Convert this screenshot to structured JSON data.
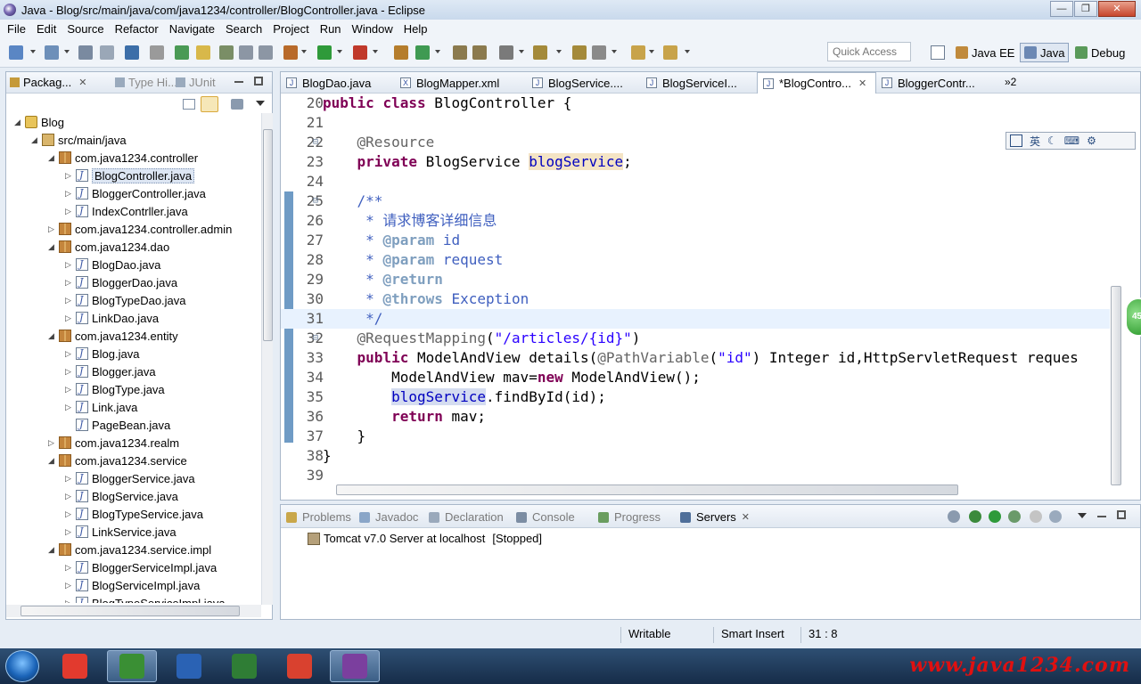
{
  "window": {
    "title": "Java - Blog/src/main/java/com/java1234/controller/BlogController.java - Eclipse"
  },
  "menu": [
    "File",
    "Edit",
    "Source",
    "Refactor",
    "Navigate",
    "Search",
    "Project",
    "Run",
    "Window",
    "Help"
  ],
  "toolbar": {
    "quick_access_placeholder": "Quick Access"
  },
  "perspectives": [
    {
      "label": "Java EE",
      "active": false
    },
    {
      "label": "Java",
      "active": true
    },
    {
      "label": "Debug",
      "active": false
    }
  ],
  "left_tabs": [
    {
      "label": "Packag...",
      "closable": true
    },
    {
      "label": "Type Hi...",
      "closable": false
    },
    {
      "label": "JUnit",
      "closable": false
    }
  ],
  "tree": [
    {
      "label": "Blog",
      "indent": 0,
      "icon": "project-icon",
      "twisty": "open"
    },
    {
      "label": "src/main/java",
      "indent": 1,
      "icon": "source-folder-icon",
      "twisty": "open"
    },
    {
      "label": "com.java1234.controller",
      "indent": 2,
      "icon": "package-icon",
      "twisty": "open"
    },
    {
      "label": "BlogController.java",
      "indent": 3,
      "icon": "java-file-icon",
      "twisty": "closed",
      "selected": true
    },
    {
      "label": "BloggerController.java",
      "indent": 3,
      "icon": "java-file-icon",
      "twisty": "closed"
    },
    {
      "label": "IndexContrller.java",
      "indent": 3,
      "icon": "java-file-icon",
      "twisty": "closed"
    },
    {
      "label": "com.java1234.controller.admin",
      "indent": 2,
      "icon": "package-icon",
      "twisty": "closed"
    },
    {
      "label": "com.java1234.dao",
      "indent": 2,
      "icon": "package-icon",
      "twisty": "open"
    },
    {
      "label": "BlogDao.java",
      "indent": 3,
      "icon": "java-file-icon",
      "twisty": "closed"
    },
    {
      "label": "BloggerDao.java",
      "indent": 3,
      "icon": "java-file-icon",
      "twisty": "closed"
    },
    {
      "label": "BlogTypeDao.java",
      "indent": 3,
      "icon": "java-file-icon",
      "twisty": "closed"
    },
    {
      "label": "LinkDao.java",
      "indent": 3,
      "icon": "java-file-icon",
      "twisty": "closed"
    },
    {
      "label": "com.java1234.entity",
      "indent": 2,
      "icon": "package-icon",
      "twisty": "open"
    },
    {
      "label": "Blog.java",
      "indent": 3,
      "icon": "java-file-icon",
      "twisty": "closed"
    },
    {
      "label": "Blogger.java",
      "indent": 3,
      "icon": "java-file-icon",
      "twisty": "closed"
    },
    {
      "label": "BlogType.java",
      "indent": 3,
      "icon": "java-file-icon",
      "twisty": "closed"
    },
    {
      "label": "Link.java",
      "indent": 3,
      "icon": "java-file-icon",
      "twisty": "closed"
    },
    {
      "label": "PageBean.java",
      "indent": 3,
      "icon": "java-file-icon",
      "twisty": "none"
    },
    {
      "label": "com.java1234.realm",
      "indent": 2,
      "icon": "package-icon",
      "twisty": "closed"
    },
    {
      "label": "com.java1234.service",
      "indent": 2,
      "icon": "package-icon",
      "twisty": "open"
    },
    {
      "label": "BloggerService.java",
      "indent": 3,
      "icon": "java-file-icon",
      "twisty": "closed"
    },
    {
      "label": "BlogService.java",
      "indent": 3,
      "icon": "java-file-icon",
      "twisty": "closed"
    },
    {
      "label": "BlogTypeService.java",
      "indent": 3,
      "icon": "java-file-icon",
      "twisty": "closed"
    },
    {
      "label": "LinkService.java",
      "indent": 3,
      "icon": "java-file-icon",
      "twisty": "closed"
    },
    {
      "label": "com.java1234.service.impl",
      "indent": 2,
      "icon": "package-icon",
      "twisty": "open"
    },
    {
      "label": "BloggerServiceImpl.java",
      "indent": 3,
      "icon": "java-file-icon",
      "twisty": "closed"
    },
    {
      "label": "BlogServiceImpl.java",
      "indent": 3,
      "icon": "java-file-icon",
      "twisty": "closed"
    },
    {
      "label": "BlogTypeServiceImpl.java",
      "indent": 3,
      "icon": "java-file-icon",
      "twisty": "closed"
    }
  ],
  "editor_tabs": [
    {
      "label": "BlogDao.java",
      "icon": "J",
      "active": false
    },
    {
      "label": "BlogMapper.xml",
      "icon": "X",
      "active": false
    },
    {
      "label": "BlogService....",
      "icon": "J",
      "active": false
    },
    {
      "label": "BlogServiceI...",
      "icon": "J",
      "active": false
    },
    {
      "label": "*BlogContro...",
      "icon": "J",
      "active": true
    },
    {
      "label": "BloggerContr...",
      "icon": "J",
      "active": false
    }
  ],
  "editor_overflow": "»2",
  "code_lines": [
    {
      "n": "20",
      "tokens": [
        [
          "kw",
          "public"
        ],
        [
          "t",
          " "
        ],
        [
          "kw",
          "class"
        ],
        [
          "t",
          " BlogController {"
        ]
      ]
    },
    {
      "n": "21",
      "tokens": []
    },
    {
      "n": "22",
      "fold": true,
      "tokens": [
        [
          "t",
          "    "
        ],
        [
          "an",
          "@Resource"
        ]
      ]
    },
    {
      "n": "23",
      "tokens": [
        [
          "t",
          "    "
        ],
        [
          "kw",
          "private"
        ],
        [
          "t",
          " BlogService "
        ],
        [
          "fldhl",
          "blogService"
        ],
        [
          "t",
          ";"
        ]
      ]
    },
    {
      "n": "24",
      "tokens": []
    },
    {
      "n": "25",
      "fold": true,
      "tokens": [
        [
          "t",
          "    "
        ],
        [
          "cm",
          "/**"
        ]
      ]
    },
    {
      "n": "26",
      "tokens": [
        [
          "cm",
          "     * 请求博客详细信息"
        ]
      ]
    },
    {
      "n": "27",
      "tokens": [
        [
          "cm",
          "     * "
        ],
        [
          "tag",
          "@param"
        ],
        [
          "cm",
          " id"
        ]
      ]
    },
    {
      "n": "28",
      "tokens": [
        [
          "cm",
          "     * "
        ],
        [
          "tag",
          "@param"
        ],
        [
          "cm",
          " request"
        ]
      ]
    },
    {
      "n": "29",
      "tokens": [
        [
          "cm",
          "     * "
        ],
        [
          "tag",
          "@return"
        ]
      ]
    },
    {
      "n": "30",
      "tokens": [
        [
          "cm",
          "     * "
        ],
        [
          "tag",
          "@throws"
        ],
        [
          "cm",
          " Exception"
        ]
      ]
    },
    {
      "n": "31",
      "current": true,
      "tokens": [
        [
          "cm",
          "     */"
        ]
      ]
    },
    {
      "n": "32",
      "fold": true,
      "tokens": [
        [
          "t",
          "    "
        ],
        [
          "an",
          "@RequestMapping"
        ],
        [
          "t",
          "("
        ],
        [
          "st",
          "\"/articles/{id}\""
        ],
        [
          "t",
          ")"
        ]
      ]
    },
    {
      "n": "33",
      "tokens": [
        [
          "t",
          "    "
        ],
        [
          "kw",
          "public"
        ],
        [
          "t",
          " ModelAndView details("
        ],
        [
          "an",
          "@PathVariable"
        ],
        [
          "t",
          "("
        ],
        [
          "st",
          "\"id\""
        ],
        [
          "t",
          ") Integer id,HttpServletRequest reques"
        ]
      ]
    },
    {
      "n": "34",
      "tokens": [
        [
          "t",
          "        ModelAndView mav="
        ],
        [
          "kw",
          "new"
        ],
        [
          "t",
          " ModelAndView();"
        ]
      ]
    },
    {
      "n": "35",
      "tokens": [
        [
          "t",
          "        "
        ],
        [
          "fldsel",
          "blogService"
        ],
        [
          "t",
          ".findById(id);"
        ]
      ]
    },
    {
      "n": "36",
      "tokens": [
        [
          "t",
          "        "
        ],
        [
          "kw",
          "return"
        ],
        [
          "t",
          " mav;"
        ]
      ]
    },
    {
      "n": "37",
      "tokens": [
        [
          "t",
          "    }"
        ]
      ]
    },
    {
      "n": "38",
      "tokens": [
        [
          "t",
          "}"
        ]
      ]
    },
    {
      "n": "39",
      "tokens": []
    }
  ],
  "ime": {
    "lang": "英"
  },
  "bottom_tabs": [
    {
      "label": "Problems",
      "active": false,
      "color": "#c9a74a"
    },
    {
      "label": "Javadoc",
      "active": false,
      "color": "#8aa6c8"
    },
    {
      "label": "Declaration",
      "active": false,
      "color": "#9aa9bb"
    },
    {
      "label": "Console",
      "active": false,
      "color": "#7c8da3"
    },
    {
      "label": "Progress",
      "active": false,
      "color": "#6a9d5f"
    },
    {
      "label": "Servers",
      "active": true,
      "color": "#4f6f9a"
    }
  ],
  "servers": [
    {
      "label": "Tomcat v7.0 Server at localhost",
      "status": "[Stopped]"
    }
  ],
  "status": {
    "writable": "Writable",
    "insert": "Smart Insert",
    "position": "31 : 8"
  },
  "badge": "45",
  "taskbar": {
    "apps": [
      {
        "name": "color-app",
        "color": "#e23a2e",
        "active": false
      },
      {
        "name": "camtasia-app",
        "color": "#3a8f34",
        "active": true
      },
      {
        "name": "word-app",
        "color": "#2a62b4",
        "active": false
      },
      {
        "name": "camtasia-recorder-app",
        "color": "#2f7d35",
        "active": false
      },
      {
        "name": "chrome-app",
        "color": "#d9412f",
        "active": false
      },
      {
        "name": "eclipse-app",
        "color": "#7b3f9e",
        "active": true
      }
    ],
    "watermark": "www.java1234.com"
  }
}
